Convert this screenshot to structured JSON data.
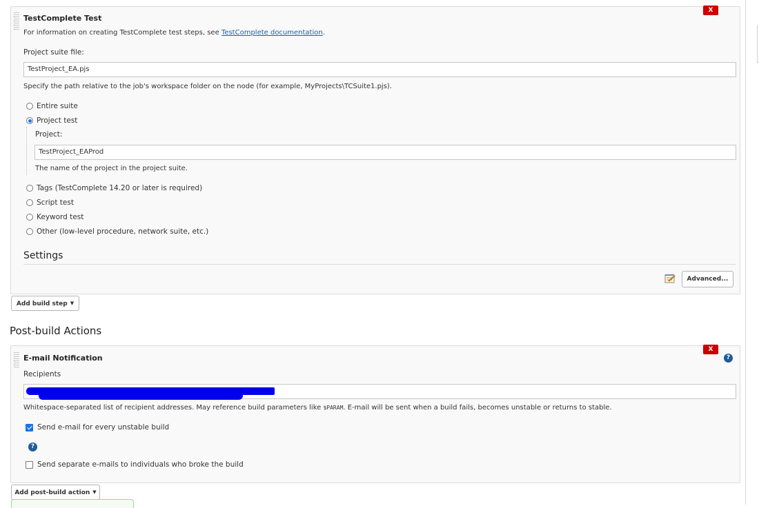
{
  "build_step": {
    "title": "TestComplete Test",
    "delete_label": "X",
    "info_prefix": "For information on creating TestComplete test steps, see ",
    "info_link": "TestComplete documentation",
    "info_suffix": ".",
    "suite_label": "Project suite file:",
    "suite_value": "TestProject_EA.pjs",
    "suite_help": "Specify the path relative to the job's workspace folder on the node (for example, MyProjects\\TCSuite1.pjs).",
    "options": [
      {
        "label": "Entire suite",
        "checked": false
      },
      {
        "label": "Project test",
        "checked": true
      },
      {
        "label": "Tags (TestComplete 14.20 or later is required)",
        "checked": false
      },
      {
        "label": "Script test",
        "checked": false
      },
      {
        "label": "Keyword test",
        "checked": false
      },
      {
        "label": "Other (low-level procedure, network suite, etc.)",
        "checked": false
      }
    ],
    "project_label": "Project:",
    "project_value": "TestProject_EAProd",
    "project_help": "The name of the project in the project suite.",
    "settings_heading": "Settings",
    "advanced_label": "Advanced..."
  },
  "add_build_step_label": "Add build step",
  "post_build": {
    "heading": "Post-build Actions",
    "title": "E-mail Notification",
    "delete_label": "X",
    "help_glyph": "?",
    "recipients_label": "Recipients",
    "recipients_help_prefix": "Whitespace-separated list of recipient addresses. May reference build parameters like ",
    "recipients_help_code": "$PARAM",
    "recipients_help_suffix": ". E-mail will be sent when a build fails, becomes unstable or returns to stable.",
    "unstable_label": "Send e-mail for every unstable build",
    "unstable_checked": true,
    "separate_label": "Send separate e-mails to individuals who broke the build",
    "separate_checked": false
  },
  "add_post_build_label": "Add post-build action",
  "colors": {
    "delete": "#cc0000",
    "link": "#1f5fa8",
    "help": "#1e5c96",
    "radio_selected": "#1a73e8",
    "redaction": "#0000ee"
  }
}
